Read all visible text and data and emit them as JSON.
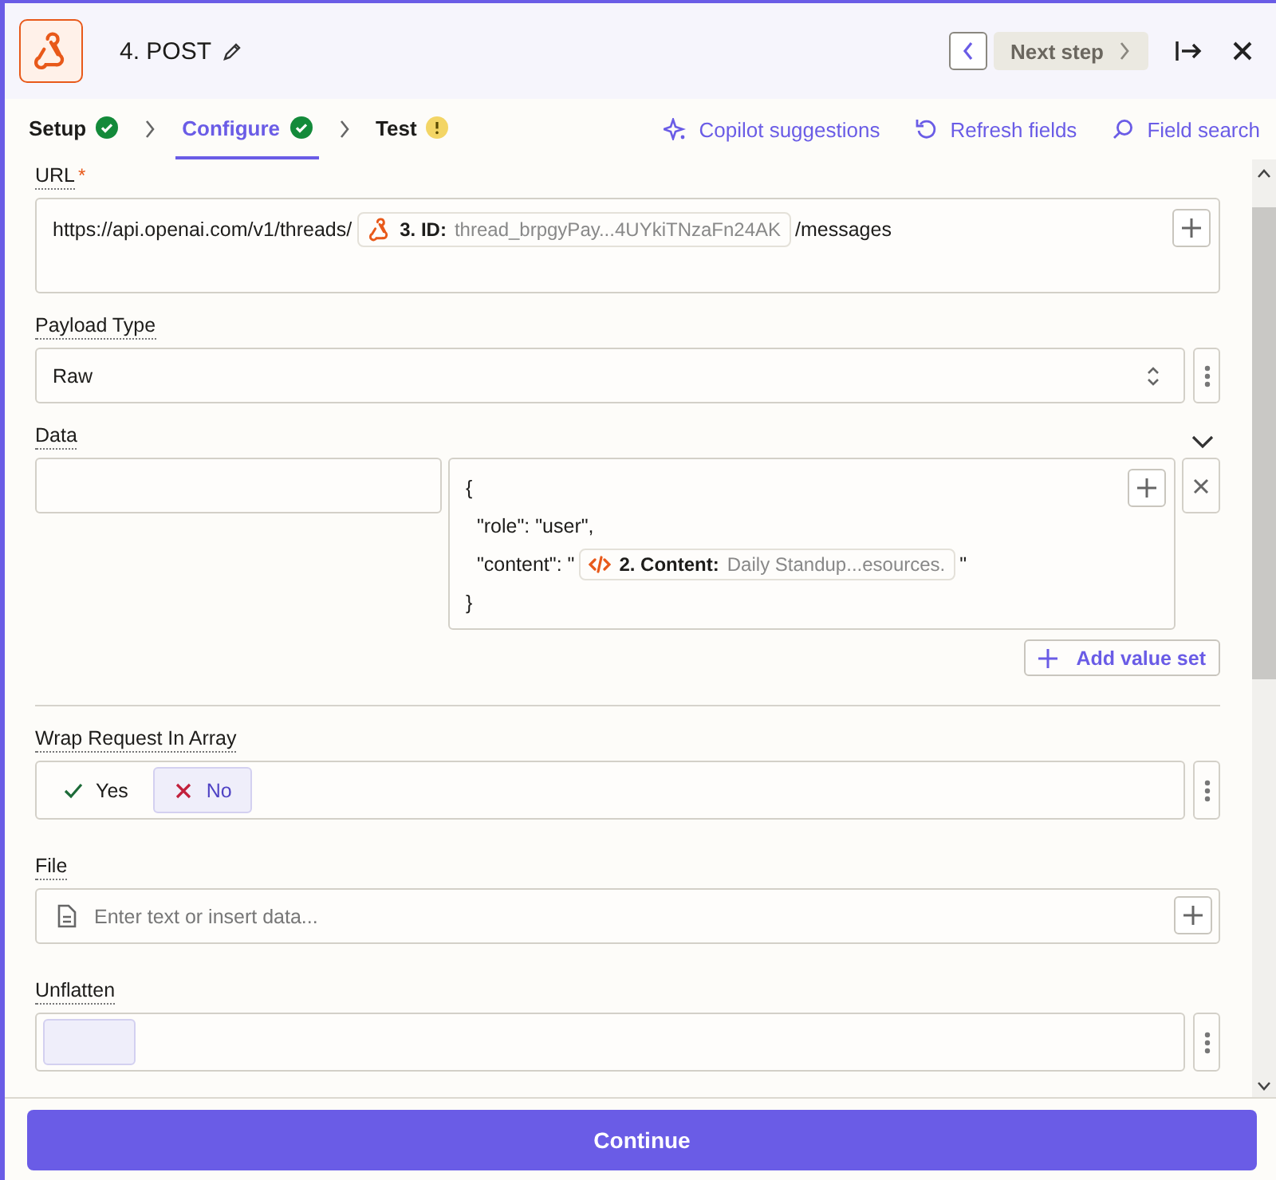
{
  "header": {
    "title": "4. POST",
    "next_label": "Next step"
  },
  "steps": [
    {
      "label": "Setup",
      "complete": true,
      "selected": false
    },
    {
      "label": "Configure",
      "complete": true,
      "selected": true
    },
    {
      "label": "Test",
      "complete": false,
      "selected": false
    }
  ],
  "actions": [
    {
      "kind": "copilot",
      "label": "Copilot suggestions"
    },
    {
      "kind": "refresh",
      "label": "Refresh fields"
    },
    {
      "kind": "search",
      "label": "Field search"
    }
  ],
  "fields": [
    {
      "kind": "tokens",
      "label": "URL",
      "required_mark": "*",
      "parts": [
        {
          "kind": "text",
          "text": "https://api.openai.com/v1/threads/"
        },
        {
          "kind": "webhook-token",
          "step": "3. ID:",
          "value": "thread_brpgyPay...4UYkiTNzaFn24AK"
        },
        {
          "kind": "text",
          "text": "/messages"
        }
      ]
    },
    {
      "kind": "select",
      "label": "Payload Type",
      "value": "Raw"
    },
    {
      "kind": "data",
      "label": "Data",
      "lines": [
        [
          {
            "kind": "text",
            "text": "{"
          }
        ],
        [
          {
            "kind": "text",
            "text": "  \"role\": \"user\","
          }
        ],
        [
          {
            "kind": "text",
            "text": "  \"content\": \""
          },
          {
            "kind": "code-token",
            "step": "2. Content:",
            "value": "Daily Standup...esources."
          },
          {
            "kind": "text",
            "text": "\""
          }
        ],
        [
          {
            "kind": "text",
            "text": "}"
          }
        ]
      ],
      "add_label": "Add value set"
    },
    {
      "kind": "divider"
    },
    {
      "kind": "choice",
      "label": "Wrap Request In Array",
      "options": [
        {
          "kind": "yes",
          "label": "Yes",
          "selected": false
        },
        {
          "kind": "no",
          "label": "No",
          "selected": true
        }
      ]
    },
    {
      "kind": "text",
      "label": "File",
      "placeholder": "Enter text or insert data..."
    },
    {
      "kind": "cut",
      "label": "Unflatten"
    }
  ],
  "footer": {
    "continue_label": "Continue"
  }
}
